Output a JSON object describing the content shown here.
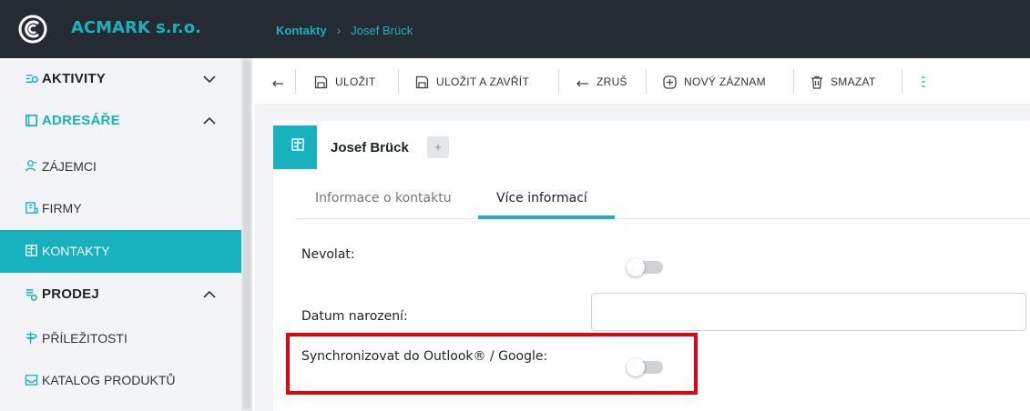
{
  "header": {
    "brand_name": "ACMARK s.r.o.",
    "breadcrumb": [
      "Kontakty",
      "Josef Brück"
    ],
    "breadcrumb_separator": "›"
  },
  "sidebar": {
    "items": [
      {
        "label": "AKTIVITY",
        "type": "section",
        "icon": "activities-icon",
        "expanded": false
      },
      {
        "label": "ADRESÁŘE",
        "type": "section",
        "icon": "address-book-icon",
        "expanded": true
      },
      {
        "label": "ZÁJEMCI",
        "type": "sub",
        "icon": "prospects-icon"
      },
      {
        "label": "FIRMY",
        "type": "sub",
        "icon": "companies-icon"
      },
      {
        "label": "KONTAKTY",
        "type": "sub",
        "icon": "contacts-icon",
        "active": true
      },
      {
        "label": "PRODEJ",
        "type": "section",
        "icon": "sales-icon",
        "expanded": true
      },
      {
        "label": "PŘÍLEŽITOSTI",
        "type": "sub",
        "icon": "opportunities-icon"
      },
      {
        "label": "KATALOG PRODUKTŮ",
        "type": "sub",
        "icon": "product-catalog-icon"
      }
    ]
  },
  "toolbar": {
    "back_icon": "back-arrow-icon",
    "save_label": "ULOŽIT",
    "save_close_label": "ULOŽIT A ZAVŘÍT",
    "cancel_label": "ZRUŠ",
    "new_record_label": "NOVÝ ZÁZNAM",
    "delete_label": "SMAZAT",
    "more_icon": "more-vertical-icon"
  },
  "record": {
    "title": "Josef Brück",
    "add_label": "+",
    "tabs": [
      {
        "label": "Informace o kontaktu",
        "active": false
      },
      {
        "label": "Více informací",
        "active": true
      }
    ]
  },
  "form": {
    "do_not_call_label": "Nevolat:",
    "do_not_call_value": false,
    "birth_date_label": "Datum narození:",
    "birth_date_value": "",
    "sync_label": "Synchronizovat do Outlook® / Google:",
    "sync_value": false
  },
  "colors": {
    "accent": "#16b3bf",
    "topbar": "#242b33",
    "sidebar": "#f2f4f5",
    "highlight": "#e3000f"
  }
}
